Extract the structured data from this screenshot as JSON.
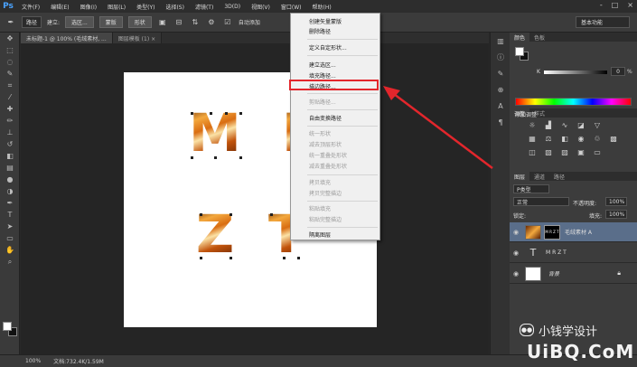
{
  "app": {
    "logo": "Ps"
  },
  "menu": [
    "文件(F)",
    "编辑(E)",
    "图像(I)",
    "图层(L)",
    "类型(Y)",
    "选择(S)",
    "滤镜(T)",
    "3D(D)",
    "视图(V)",
    "窗口(W)",
    "帮助(H)"
  ],
  "window_controls": [
    "-",
    "□",
    "×"
  ],
  "options": {
    "mode": "路径",
    "make_label": "建立:",
    "selection_btn": "选区...",
    "mask_btn": "蒙版",
    "shape_btn": "形状",
    "auto_add_label": "自动添加",
    "workspace": "基本功能"
  },
  "document_tabs": [
    "未标题-1 @ 100% (毛绒素材, ...",
    "图层模板 (1) ×"
  ],
  "canvas": {
    "letters": [
      "M",
      "R",
      "Z",
      "T"
    ]
  },
  "status": {
    "zoom": "100%",
    "doc_info": "文档:732.4K/1.59M"
  },
  "context_menu": {
    "items": [
      {
        "label": "创建矢量蒙版",
        "disabled": false
      },
      {
        "label": "删除路径",
        "disabled": false
      },
      {
        "label": "定义自定形状...",
        "disabled": false
      },
      {
        "label": "建立选区...",
        "disabled": false
      },
      {
        "label": "填充路径...",
        "disabled": false
      },
      {
        "label": "描边路径...",
        "disabled": false
      },
      {
        "label": "剪贴路径...",
        "disabled": true
      },
      {
        "label": "自由变换路径",
        "disabled": false
      },
      {
        "label": "统一形状",
        "disabled": true
      },
      {
        "label": "减去顶层形状",
        "disabled": true
      },
      {
        "label": "统一重叠处形状",
        "disabled": true
      },
      {
        "label": "减去重叠处形状",
        "disabled": true
      },
      {
        "label": "拷贝填充",
        "disabled": true
      },
      {
        "label": "拷贝完整描边",
        "disabled": true
      },
      {
        "label": "粘贴填充",
        "disabled": true
      },
      {
        "label": "粘贴完整描边",
        "disabled": true
      },
      {
        "label": "隔离图层",
        "disabled": false
      }
    ],
    "highlighted": "描边路径..."
  },
  "color_panel": {
    "tabs": [
      "颜色",
      "色板"
    ],
    "channel": "K",
    "value": "0",
    "unit": "%"
  },
  "adjust_panel": {
    "tabs": [
      "调整",
      "样式"
    ],
    "title": "添加调整"
  },
  "layers_panel": {
    "tabs": [
      "图层",
      "通道",
      "路径"
    ],
    "filter": "P类型",
    "blend_mode": "正常",
    "opacity_label": "不透明度:",
    "opacity": "100%",
    "lock_label": "锁定:",
    "fill_label": "填充:",
    "fill": "100%",
    "layers": [
      {
        "name": "毛绒素材 A",
        "mask_text": "M R\nZ T",
        "selected": true
      },
      {
        "name": "M R Z T",
        "type": "text",
        "selected": false
      },
      {
        "name": "背景",
        "selected": false
      }
    ]
  },
  "watermark": {
    "brand": "小钱学设计",
    "site": "UiBQ.CoM",
    "logo": "●●"
  }
}
